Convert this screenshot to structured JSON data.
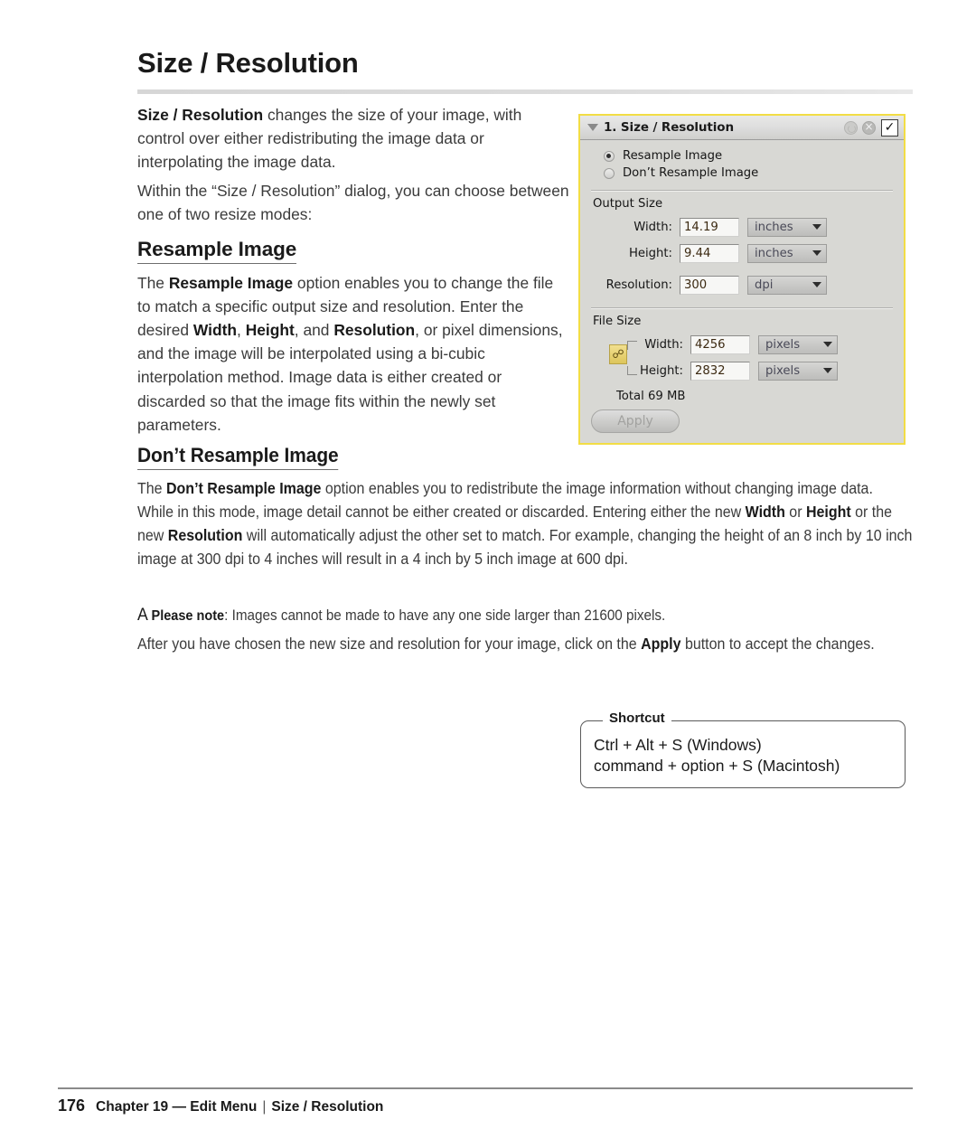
{
  "page": {
    "title": "Size / Resolution",
    "number": "176",
    "footer_chapter": "Chapter 19 — Edit Menu",
    "footer_separator": "|",
    "footer_section": "Size / Resolution"
  },
  "intro": {
    "p1_bold": "Size / Resolution",
    "p1_rest": " changes the size of your image, with control over either redistributing the image data or interpolating the image data.",
    "p2": "Within the “Size / Resolution” dialog, you can choose between one of two resize modes:"
  },
  "resample": {
    "heading": "Resample Image",
    "body_1": "The ",
    "body_b1": "Resample Image",
    "body_2": " option enables you to change the file to match a specific output size and resolution. Enter the desired ",
    "body_b2": "Width",
    "body_3": ", ",
    "body_b3": "Height",
    "body_4": ", and ",
    "body_b4": "Resolution",
    "body_5": ", or pixel dimensions, and the image will be interpolated using a bi-cubic interpolation method. Image data is either created or discarded so that the image fits within the newly set parameters."
  },
  "dont_resample": {
    "heading": "Don’t Resample Image",
    "body_1": "The ",
    "body_b1": "Don’t Resample Image",
    "body_2": " option enables you to redistribute the image information without changing image data. While in this mode, image detail cannot be either created or discarded. Entering either the new ",
    "body_b2": "Width",
    "body_3": " or ",
    "body_b3": "Height",
    "body_4": " or the new ",
    "body_b4": "Resolution",
    "body_5": " will automatically adjust the other set to match. For example, changing the height of an 8 inch by 10 inch image at 300 dpi to 4 inches will result in a 4 inch by 5 inch image at 600 dpi."
  },
  "note": {
    "symbol": "A",
    "label": "Please note",
    "text": ": Images cannot be made to have any one side larger than 21600 pixels."
  },
  "closing": {
    "part1": "After you have chosen the new size and resolution for your image, click on the ",
    "bold": "Apply",
    "part2": " button to accept the changes."
  },
  "shortcut": {
    "legend": "Shortcut",
    "line1": "Ctrl + Alt + S (Windows)",
    "line2": "command + option + S (Macintosh)"
  },
  "dialog": {
    "title": "1. Size / Resolution",
    "titlebar_icons": [
      "disclosure-triangle-icon",
      "reset-icon",
      "close-icon",
      "checkmark-icon"
    ],
    "checkmark": "✓",
    "radios": [
      {
        "label": "Resample Image",
        "selected": true
      },
      {
        "label": "Don’t Resample Image",
        "selected": false
      }
    ],
    "output_size": {
      "group_label": "Output Size",
      "fields": [
        {
          "label": "Width:",
          "value": "14.19",
          "unit": "inches"
        },
        {
          "label": "Height:",
          "value": "9.44",
          "unit": "inches"
        },
        {
          "label": "Resolution:",
          "value": "300",
          "unit": "dpi"
        }
      ]
    },
    "file_size": {
      "group_label": "File Size",
      "fields": [
        {
          "label": "Width:",
          "value": "4256",
          "unit": "pixels"
        },
        {
          "label": "Height:",
          "value": "2832",
          "unit": "pixels"
        }
      ],
      "lock_icon": "chain-link-lock-icon",
      "total": "Total 69 MB"
    },
    "apply_label": "Apply",
    "colors": {
      "border": "#f2dd45",
      "body_background": "#d8d8d4",
      "titlebar": "#dedede",
      "lock_highlight": "#e6ce6b"
    }
  }
}
